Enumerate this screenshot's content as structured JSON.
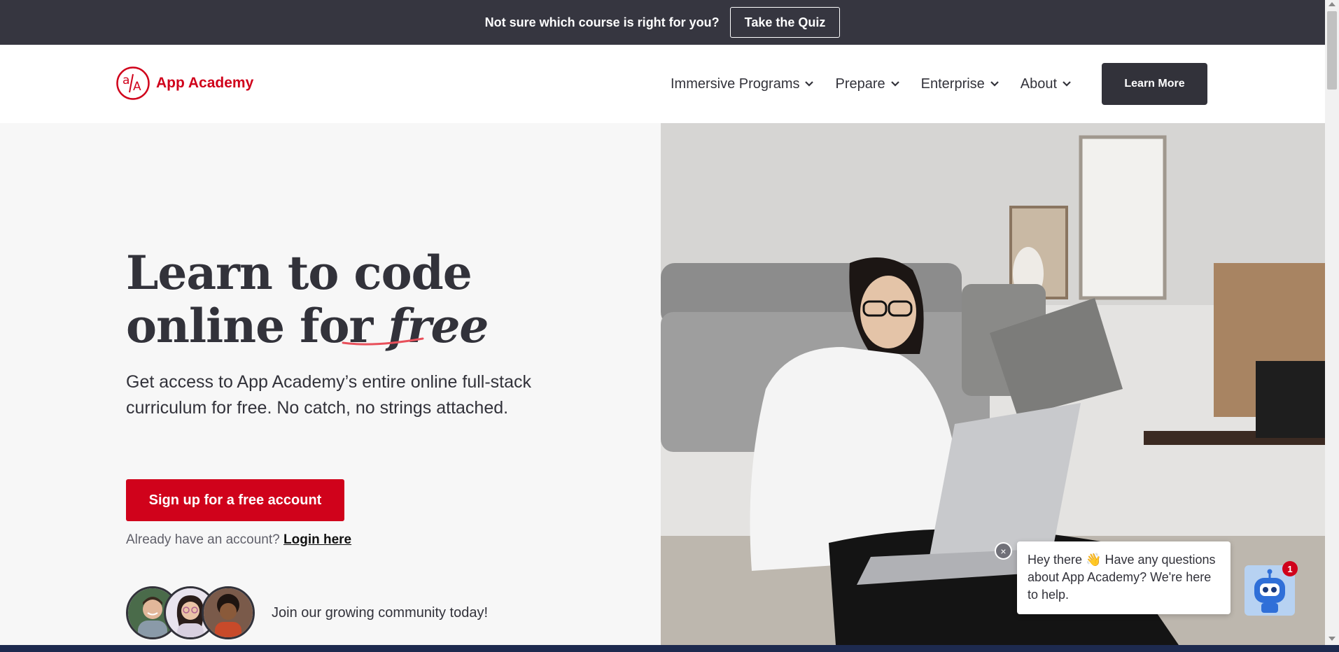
{
  "banner": {
    "text": "Not sure which course is right for you?",
    "quiz_label": "Take the Quiz"
  },
  "header": {
    "logo_text": "App Academy",
    "nav": [
      {
        "label": "Immersive Programs"
      },
      {
        "label": "Prepare"
      },
      {
        "label": "Enterprise"
      },
      {
        "label": "About"
      }
    ],
    "cta_label": "Learn More"
  },
  "hero": {
    "title_line1": "Learn to code",
    "title_line2_prefix": "online for ",
    "title_emphasis": "free",
    "description": "Get access to App Academy’s entire online full-stack curriculum for free. No catch, no strings attached.",
    "signup_label": "Sign up for a free account",
    "login_prompt": "Already have an account?",
    "login_link": "Login here",
    "community_text": "Join our growing community today!"
  },
  "chat": {
    "close_icon": "×",
    "message": "Hey there 👋 Have any questions about App Academy? We're here to help.",
    "badge_count": "1"
  },
  "colors": {
    "brand_red": "#d0021b",
    "dark": "#32323a",
    "banner_bg": "#363640"
  }
}
